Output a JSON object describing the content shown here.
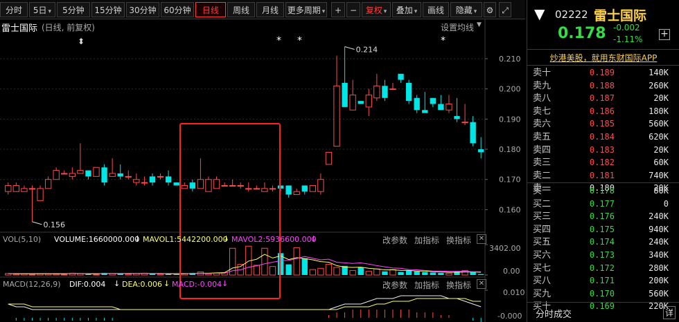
{
  "toolbar": {
    "items": [
      {
        "label": "分时",
        "active": false
      },
      {
        "label": "5日",
        "active": false,
        "drop": true
      },
      {
        "label": "5分钟",
        "active": false
      },
      {
        "label": "15分钟",
        "active": false
      },
      {
        "label": "30分钟",
        "active": false
      },
      {
        "label": "60分钟",
        "active": false
      },
      {
        "label": "日线",
        "active": true
      },
      {
        "label": "周线",
        "active": false
      },
      {
        "label": "月线",
        "active": false
      },
      {
        "label": "更多周期",
        "active": false,
        "drop": true
      },
      {
        "label": "+",
        "active": false
      },
      {
        "label": "−",
        "active": false
      },
      {
        "label": "复权",
        "active": false,
        "drop": true,
        "red": true
      },
      {
        "label": "叠加",
        "active": false,
        "drop": true
      },
      {
        "label": "画线",
        "active": false
      },
      {
        "label": "隐藏",
        "active": false,
        "drop": true
      }
    ],
    "icons": [
      "settings-icon",
      "fullscreen-icon"
    ]
  },
  "chart": {
    "title": "雷士国际",
    "subtitle": "(日线, 前复权)",
    "settings_label": "设置均线",
    "y_labels": [
      "0.210",
      "0.200",
      "0.190",
      "0.180",
      "0.170",
      "0.160"
    ],
    "high_label": "0.214",
    "low_label": "0.156",
    "stars": [
      "*",
      "*",
      "*"
    ],
    "flag": "⬍",
    "vol": {
      "name": "VOL(5,10)",
      "volume": "VOLUME:1660000.000",
      "mavol1": "MAVOL1:5442200.000",
      "mavol2": "MAVOL2:5936600.000",
      "y_top": "3402.00",
      "y_zero": "0.00",
      "params": "改参数",
      "add": "加指标",
      "swap": "换指标",
      "close": "✕"
    },
    "macd": {
      "name": "MACD(12,26,9)",
      "dif": "DIF:0.004",
      "dea": "DEA:0.006",
      "macd": "MACD:-0.004",
      "y_top": "0.010",
      "y_bottom": "-0.000",
      "params": "改参数",
      "add": "加指标",
      "swap": "换指标",
      "close": "✕"
    },
    "colors": {
      "up": "#ff4a4a",
      "down": "#00e5e5",
      "mavol1": "#ffff66",
      "mavol2": "#ff44ff",
      "highlight": "#ff2020"
    }
  },
  "chart_data": {
    "type": "candlestick",
    "ylim": [
      0.153,
      0.218
    ],
    "candles": [
      [
        0.166,
        0.168,
        0.169,
        0.165
      ],
      [
        0.166,
        0.168,
        0.169,
        0.166
      ],
      [
        0.166,
        0.167,
        0.168,
        0.166
      ],
      [
        0.167,
        0.167,
        0.168,
        0.156
      ],
      [
        0.163,
        0.167,
        0.168,
        0.163
      ],
      [
        0.167,
        0.17,
        0.171,
        0.167
      ],
      [
        0.17,
        0.173,
        0.174,
        0.17
      ],
      [
        0.172,
        0.172,
        0.173,
        0.172
      ],
      [
        0.171,
        0.172,
        0.174,
        0.17
      ],
      [
        0.172,
        0.173,
        0.182,
        0.172
      ],
      [
        0.173,
        0.171,
        0.173,
        0.17
      ],
      [
        0.171,
        0.174,
        0.174,
        0.171
      ],
      [
        0.174,
        0.169,
        0.175,
        0.168
      ],
      [
        0.171,
        0.172,
        0.177,
        0.171
      ],
      [
        0.172,
        0.171,
        0.175,
        0.17
      ],
      [
        0.171,
        0.171,
        0.173,
        0.17
      ],
      [
        0.169,
        0.17,
        0.172,
        0.168
      ],
      [
        0.169,
        0.169,
        0.171,
        0.168
      ],
      [
        0.171,
        0.169,
        0.172,
        0.168
      ],
      [
        0.171,
        0.171,
        0.172,
        0.17
      ],
      [
        0.171,
        0.169,
        0.173,
        0.168
      ],
      [
        0.169,
        0.168,
        0.169,
        0.168
      ],
      [
        0.167,
        0.168,
        0.169,
        0.167
      ],
      [
        0.169,
        0.167,
        0.17,
        0.166
      ],
      [
        0.167,
        0.17,
        0.177,
        0.167
      ],
      [
        0.166,
        0.17,
        0.171,
        0.166
      ],
      [
        0.167,
        0.17,
        0.171,
        0.167
      ],
      [
        0.168,
        0.168,
        0.169,
        0.168
      ],
      [
        0.168,
        0.168,
        0.17,
        0.168
      ],
      [
        0.168,
        0.168,
        0.169,
        0.167
      ],
      [
        0.167,
        0.167,
        0.169,
        0.166
      ],
      [
        0.167,
        0.167,
        0.168,
        0.167
      ],
      [
        0.166,
        0.167,
        0.169,
        0.166
      ],
      [
        0.167,
        0.167,
        0.168,
        0.166
      ],
      [
        0.168,
        0.167,
        0.168,
        0.166
      ],
      [
        0.168,
        0.165,
        0.168,
        0.164
      ],
      [
        0.165,
        0.166,
        0.167,
        0.165
      ],
      [
        0.168,
        0.166,
        0.168,
        0.165
      ],
      [
        0.166,
        0.168,
        0.168,
        0.166
      ],
      [
        0.166,
        0.17,
        0.172,
        0.165
      ],
      [
        0.175,
        0.179,
        0.179,
        0.175
      ],
      [
        0.181,
        0.201,
        0.211,
        0.181
      ],
      [
        0.202,
        0.194,
        0.214,
        0.194
      ],
      [
        0.193,
        0.198,
        0.203,
        0.193
      ],
      [
        0.196,
        0.195,
        0.196,
        0.195
      ],
      [
        0.194,
        0.198,
        0.2,
        0.191
      ],
      [
        0.197,
        0.201,
        0.205,
        0.196
      ],
      [
        0.201,
        0.197,
        0.203,
        0.196
      ],
      [
        0.2,
        0.2,
        0.202,
        0.2
      ],
      [
        0.205,
        0.203,
        0.205,
        0.202
      ],
      [
        0.202,
        0.196,
        0.203,
        0.195
      ],
      [
        0.197,
        0.193,
        0.198,
        0.192
      ],
      [
        0.193,
        0.192,
        0.199,
        0.192
      ],
      [
        0.197,
        0.195,
        0.197,
        0.194
      ],
      [
        0.195,
        0.193,
        0.198,
        0.193
      ],
      [
        0.193,
        0.195,
        0.198,
        0.192
      ],
      [
        0.191,
        0.19,
        0.197,
        0.189
      ],
      [
        0.189,
        0.189,
        0.195,
        0.188
      ],
      [
        0.189,
        0.182,
        0.191,
        0.181
      ],
      [
        0.18,
        0.179,
        0.184,
        0.177
      ]
    ],
    "volume": [
      0.05,
      0.03,
      0.04,
      0.02,
      0.05,
      0.04,
      0.03,
      0.02,
      0.06,
      0.05,
      0.03,
      0.02,
      0.07,
      0.05,
      0.04,
      0.03,
      0.05,
      0.06,
      0.04,
      0.03,
      0.04,
      0.03,
      0.05,
      0.07,
      0.1,
      0.04,
      0.06,
      0.08,
      0.88,
      0.35,
      0.95,
      0.32,
      0.88,
      0.28,
      0.72,
      0.35,
      0.9,
      0.55,
      0.18,
      0.22,
      0.35,
      0.25,
      0.3,
      0.15,
      0.25,
      0.12,
      0.2,
      0.12,
      0.18,
      0.1,
      0.15,
      0.12,
      0.1,
      0.08,
      0.07,
      0.06,
      0.12,
      0.15,
      0.1,
      0.03
    ],
    "mavol1": [
      0.05,
      0.04,
      0.04,
      0.04,
      0.04,
      0.04,
      0.04,
      0.04,
      0.05,
      0.05,
      0.04,
      0.04,
      0.05,
      0.05,
      0.05,
      0.05,
      0.05,
      0.05,
      0.05,
      0.05,
      0.04,
      0.04,
      0.04,
      0.05,
      0.06,
      0.06,
      0.07,
      0.08,
      0.23,
      0.28,
      0.46,
      0.52,
      0.68,
      0.56,
      0.63,
      0.51,
      0.57,
      0.54,
      0.5,
      0.44,
      0.42,
      0.31,
      0.26,
      0.25,
      0.26,
      0.22,
      0.2,
      0.17,
      0.17,
      0.15,
      0.15,
      0.13,
      0.13,
      0.11,
      0.1,
      0.09,
      0.09,
      0.1,
      0.1,
      0.09
    ],
    "mavol2": [
      0.05,
      0.05,
      0.05,
      0.05,
      0.05,
      0.05,
      0.05,
      0.05,
      0.05,
      0.05,
      0.05,
      0.05,
      0.05,
      0.05,
      0.05,
      0.05,
      0.05,
      0.05,
      0.05,
      0.05,
      0.05,
      0.05,
      0.05,
      0.05,
      0.05,
      0.05,
      0.06,
      0.06,
      0.14,
      0.17,
      0.26,
      0.3,
      0.37,
      0.42,
      0.47,
      0.48,
      0.54,
      0.61,
      0.55,
      0.5,
      0.52,
      0.42,
      0.4,
      0.38,
      0.4,
      0.36,
      0.31,
      0.27,
      0.23,
      0.22,
      0.18,
      0.17,
      0.15,
      0.13,
      0.13,
      0.12,
      0.12,
      0.12,
      0.11,
      0.11
    ],
    "macd_dif": [
      0.005,
      0.004,
      0.004,
      0.003,
      0.003,
      0.003,
      0.003,
      0.003,
      0.003,
      0.003,
      0.003,
      0.003,
      0.003,
      0.003,
      0.003,
      0.003,
      0.003,
      0.003,
      0.003,
      0.003,
      0.003,
      0.003,
      0.003,
      0.003,
      0.003,
      0.003,
      0.003,
      0.003,
      0.003,
      0.003,
      0.003,
      0.003,
      0.003,
      0.003,
      0.003,
      0.003,
      0.003,
      0.003,
      0.003,
      0.003,
      0.003,
      0.004,
      0.005,
      0.005,
      0.005,
      0.006,
      0.007,
      0.007,
      0.007,
      0.008,
      0.008,
      0.008,
      0.008,
      0.008,
      0.008,
      0.007,
      0.007,
      0.006,
      0.005,
      0.004
    ],
    "macd_dea": [
      0.005,
      0.005,
      0.005,
      0.004,
      0.004,
      0.004,
      0.004,
      0.004,
      0.004,
      0.004,
      0.004,
      0.004,
      0.004,
      0.004,
      0.003,
      0.003,
      0.003,
      0.003,
      0.003,
      0.003,
      0.003,
      0.003,
      0.003,
      0.003,
      0.003,
      0.003,
      0.003,
      0.003,
      0.003,
      0.003,
      0.003,
      0.003,
      0.003,
      0.003,
      0.003,
      0.003,
      0.003,
      0.003,
      0.003,
      0.003,
      0.003,
      0.003,
      0.004,
      0.004,
      0.004,
      0.004,
      0.005,
      0.005,
      0.006,
      0.006,
      0.006,
      0.007,
      0.007,
      0.007,
      0.007,
      0.007,
      0.007,
      0.007,
      0.006,
      0.006
    ],
    "macd_bar": [
      0.0,
      -0.001,
      -0.001,
      -0.001,
      -0.001,
      -0.001,
      -0.001,
      -0.001,
      -0.001,
      -0.001,
      -0.001,
      -0.001,
      -0.001,
      -0.001,
      0.0,
      0.0,
      0.0,
      0.0,
      0.0,
      0.0,
      0.0,
      0.0,
      0.0,
      0.0,
      0.0,
      0.0,
      0.0,
      0.0,
      0.0,
      0.0,
      0.0,
      0.0,
      0.0,
      0.0,
      0.0,
      0.0,
      0.0,
      0.0,
      0.0,
      0.0,
      0.001,
      0.002,
      0.002,
      0.003,
      0.003,
      0.003,
      0.003,
      0.003,
      0.003,
      0.003,
      0.003,
      0.002,
      0.002,
      0.002,
      0.001,
      0.001,
      0.0,
      0.0,
      -0.001,
      -0.004
    ],
    "macd_ylim": [
      -0.001,
      0.01
    ],
    "high": 0.214,
    "low": 0.156
  },
  "panel": {
    "code": "02222",
    "name": "雷士国际",
    "price": "0.178",
    "change": "-0.002",
    "change_pct": "-1.11%",
    "ad": "炒港美股，就用东财国际APP",
    "add_icon": "+",
    "asks": [
      {
        "label": "卖十",
        "price": "0.189",
        "vol": "140K",
        "color": "up"
      },
      {
        "label": "卖九",
        "price": "0.188",
        "vol": "260K",
        "color": "up"
      },
      {
        "label": "卖八",
        "price": "0.187",
        "vol": "20K",
        "color": "up"
      },
      {
        "label": "卖七",
        "price": "0.186",
        "vol": "180K",
        "color": "up"
      },
      {
        "label": "卖六",
        "price": "0.185",
        "vol": "560K",
        "color": "up"
      },
      {
        "label": "卖五",
        "price": "0.184",
        "vol": "620K",
        "color": "up"
      },
      {
        "label": "卖四",
        "price": "0.183",
        "vol": "20K",
        "color": "up"
      },
      {
        "label": "卖三",
        "price": "0.182",
        "vol": "60K",
        "color": "up"
      },
      {
        "label": "卖二",
        "price": "0.181",
        "vol": "740K",
        "color": "up"
      },
      {
        "label": "卖一",
        "price": "0.180",
        "vol": "20K",
        "color": "wh"
      }
    ],
    "bids": [
      {
        "label": "买一",
        "price": "0.178",
        "vol": "80K",
        "color": "dn"
      },
      {
        "label": "买二",
        "price": "0.177",
        "vol": "0",
        "color": "dn"
      },
      {
        "label": "买三",
        "price": "0.176",
        "vol": "240K",
        "color": "dn"
      },
      {
        "label": "买四",
        "price": "0.175",
        "vol": "940K",
        "color": "dn"
      },
      {
        "label": "买五",
        "price": "0.174",
        "vol": "240K",
        "color": "dn"
      },
      {
        "label": "买六",
        "price": "0.173",
        "vol": "340K",
        "color": "dn"
      },
      {
        "label": "买七",
        "price": "0.172",
        "vol": "280K",
        "color": "dn"
      },
      {
        "label": "买八",
        "price": "0.171",
        "vol": "200K",
        "color": "dn"
      },
      {
        "label": "买九",
        "price": "0.170",
        "vol": "560K",
        "color": "dn"
      },
      {
        "label": "买十",
        "price": "0.169",
        "vol": "220K",
        "color": "dn"
      }
    ],
    "footer": "分时成交",
    "detail": "详"
  }
}
